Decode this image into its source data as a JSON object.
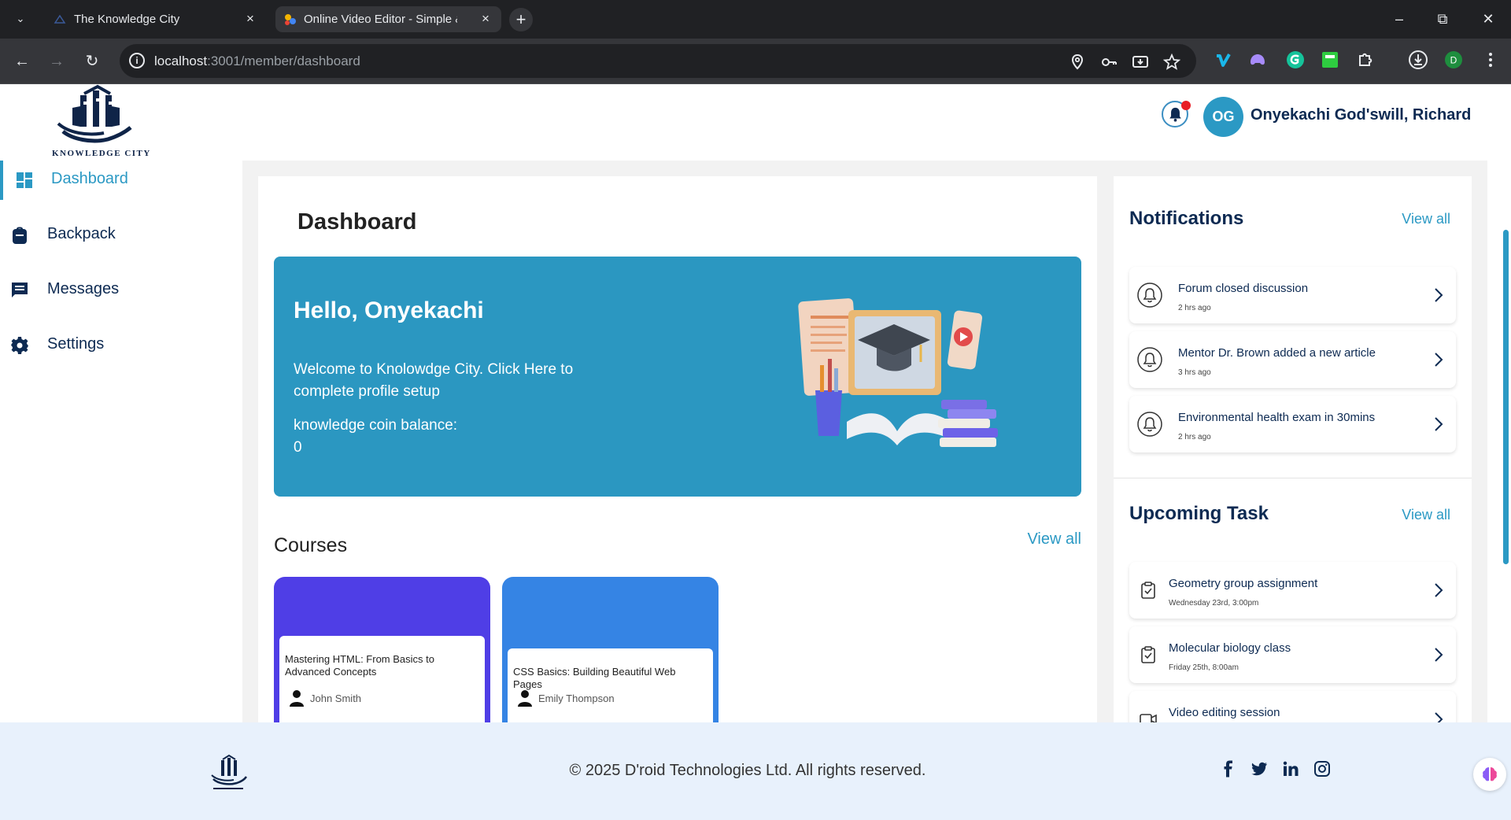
{
  "browser": {
    "tabs": [
      {
        "title": "The Knowledge City",
        "active": false
      },
      {
        "title": "Online Video Editor - Simple & Powerful",
        "active": true
      }
    ],
    "url_host": "localhost",
    "url_rest": ":3001/member/dashboard"
  },
  "brand": {
    "logo_text": "KNOWLEDGE CITY"
  },
  "header": {
    "avatar_initials": "OG",
    "user_name": "Onyekachi God'swill, Richard"
  },
  "sidebar": {
    "items": [
      {
        "label": "Dashboard",
        "icon": "dashboard-icon",
        "active": true
      },
      {
        "label": "Backpack",
        "icon": "backpack-icon",
        "active": false
      },
      {
        "label": "Messages",
        "icon": "messages-icon",
        "active": false
      },
      {
        "label": "Settings",
        "icon": "gear-icon",
        "active": false
      }
    ]
  },
  "main": {
    "title": "Dashboard",
    "hero": {
      "greeting": "Hello, Onyekachi",
      "welcome": "Welcome to Knolowdge City. Click Here to complete profile setup",
      "coin_label": "knowledge coin balance:",
      "coin_value": "0"
    },
    "courses": {
      "title": "Courses",
      "view_all": "View all",
      "items": [
        {
          "title": "Mastering HTML: From Basics to Advanced Concepts",
          "author": "John Smith",
          "color": "#4f3ee6"
        },
        {
          "title": "CSS Basics: Building Beautiful Web Pages",
          "author": "Emily Thompson",
          "color": "#3584e4"
        }
      ]
    }
  },
  "notifications": {
    "title": "Notifications",
    "view_all": "View all",
    "items": [
      {
        "text": "Forum closed discussion",
        "time": "2 hrs ago"
      },
      {
        "text": "Mentor Dr. Brown added a new article",
        "time": "3 hrs ago"
      },
      {
        "text": "Environmental health exam in 30mins",
        "time": "2 hrs ago"
      }
    ]
  },
  "tasks": {
    "title": "Upcoming Task",
    "view_all": "View all",
    "items": [
      {
        "text": "Geometry group assignment",
        "time": "Wednesday 23rd, 3:00pm"
      },
      {
        "text": "Molecular biology class",
        "time": "Friday 25th, 8:00am"
      },
      {
        "text": "Video editing session",
        "time": ""
      }
    ]
  },
  "footer": {
    "copyright": "© 2025 D'roid Technologies Ltd. All rights reserved."
  },
  "colors": {
    "primary": "#2b99c4",
    "navy": "#0d2a52",
    "notification_dot": "#e81e26",
    "footer_bg": "#e8f1fc"
  }
}
